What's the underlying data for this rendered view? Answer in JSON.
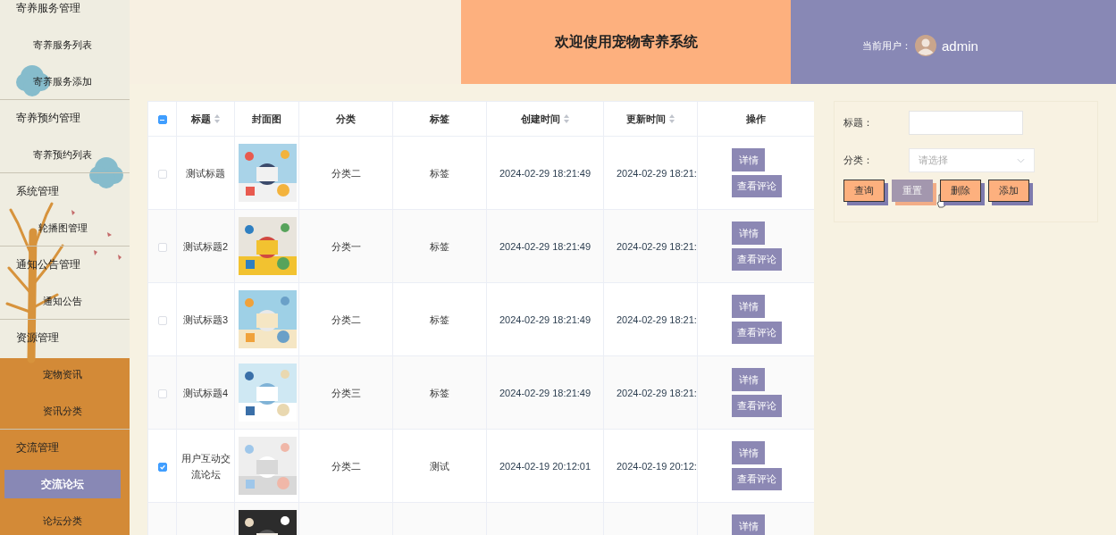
{
  "sidebar": {
    "groups": [
      {
        "label": "寄养服务管理",
        "children": [
          {
            "label": "寄养服务列表",
            "selected": false
          },
          {
            "label": "寄养服务添加",
            "selected": false
          }
        ]
      },
      {
        "label": "寄养预约管理",
        "children": [
          {
            "label": "寄养预约列表",
            "selected": false
          }
        ]
      },
      {
        "label": "系统管理",
        "children": [
          {
            "label": "轮播图管理",
            "selected": false
          }
        ]
      },
      {
        "label": "通知公告管理",
        "children": [
          {
            "label": "通知公告",
            "selected": false
          }
        ]
      },
      {
        "label": "资源管理",
        "children": [
          {
            "label": "宠物资讯",
            "selected": false
          },
          {
            "label": "资讯分类",
            "selected": false
          }
        ]
      },
      {
        "label": "交流管理",
        "children": [
          {
            "label": "交流论坛",
            "selected": true
          },
          {
            "label": "论坛分类",
            "selected": false
          }
        ]
      }
    ]
  },
  "header": {
    "title": "欢迎使用宠物寄养系统",
    "user_label": "当前用户：",
    "username": "admin"
  },
  "table": {
    "select_all": {
      "indeterminate": true
    },
    "columns": [
      {
        "label": "标题",
        "sortable": true
      },
      {
        "label": "封面图",
        "sortable": false
      },
      {
        "label": "分类",
        "sortable": false
      },
      {
        "label": "标签",
        "sortable": false
      },
      {
        "label": "创建时间",
        "sortable": true
      },
      {
        "label": "更新时间",
        "sortable": true
      },
      {
        "label": "操作",
        "sortable": false
      }
    ],
    "rows": [
      {
        "checked": false,
        "title": "测试标题",
        "category": "分类二",
        "tag": "标签",
        "created": "2024-02-29 18:21:49",
        "updated": "2024-02-29 18:21:",
        "actions": [
          "详情",
          "查看评论"
        ]
      },
      {
        "checked": false,
        "title": "测试标题2",
        "category": "分类一",
        "tag": "标签",
        "created": "2024-02-29 18:21:49",
        "updated": "2024-02-29 18:21:",
        "actions": [
          "详情",
          "查看评论"
        ]
      },
      {
        "checked": false,
        "title": "测试标题3",
        "category": "分类二",
        "tag": "标签",
        "created": "2024-02-29 18:21:49",
        "updated": "2024-02-29 18:21:",
        "actions": [
          "详情",
          "查看评论"
        ]
      },
      {
        "checked": false,
        "title": "测试标题4",
        "category": "分类三",
        "tag": "标签",
        "created": "2024-02-29 18:21:49",
        "updated": "2024-02-29 18:21:",
        "actions": [
          "详情",
          "查看评论"
        ]
      },
      {
        "checked": true,
        "title": "用户互动交流论坛",
        "category": "分类二",
        "tag": "测试",
        "created": "2024-02-19 20:12:01",
        "updated": "2024-02-19 20:12:",
        "actions": [
          "详情",
          "查看评论"
        ]
      },
      {
        "actions": [
          "详情"
        ]
      }
    ]
  },
  "search": {
    "fields": [
      {
        "kind": "text",
        "label": "标题："
      },
      {
        "kind": "select",
        "label": "分类：",
        "placeholder": "请选择"
      }
    ],
    "buttons": [
      {
        "label": "查询",
        "hovered": false
      },
      {
        "label": "重置",
        "hovered": true
      },
      {
        "label": "删除",
        "hovered": false
      },
      {
        "label": "添加",
        "hovered": false
      }
    ]
  }
}
